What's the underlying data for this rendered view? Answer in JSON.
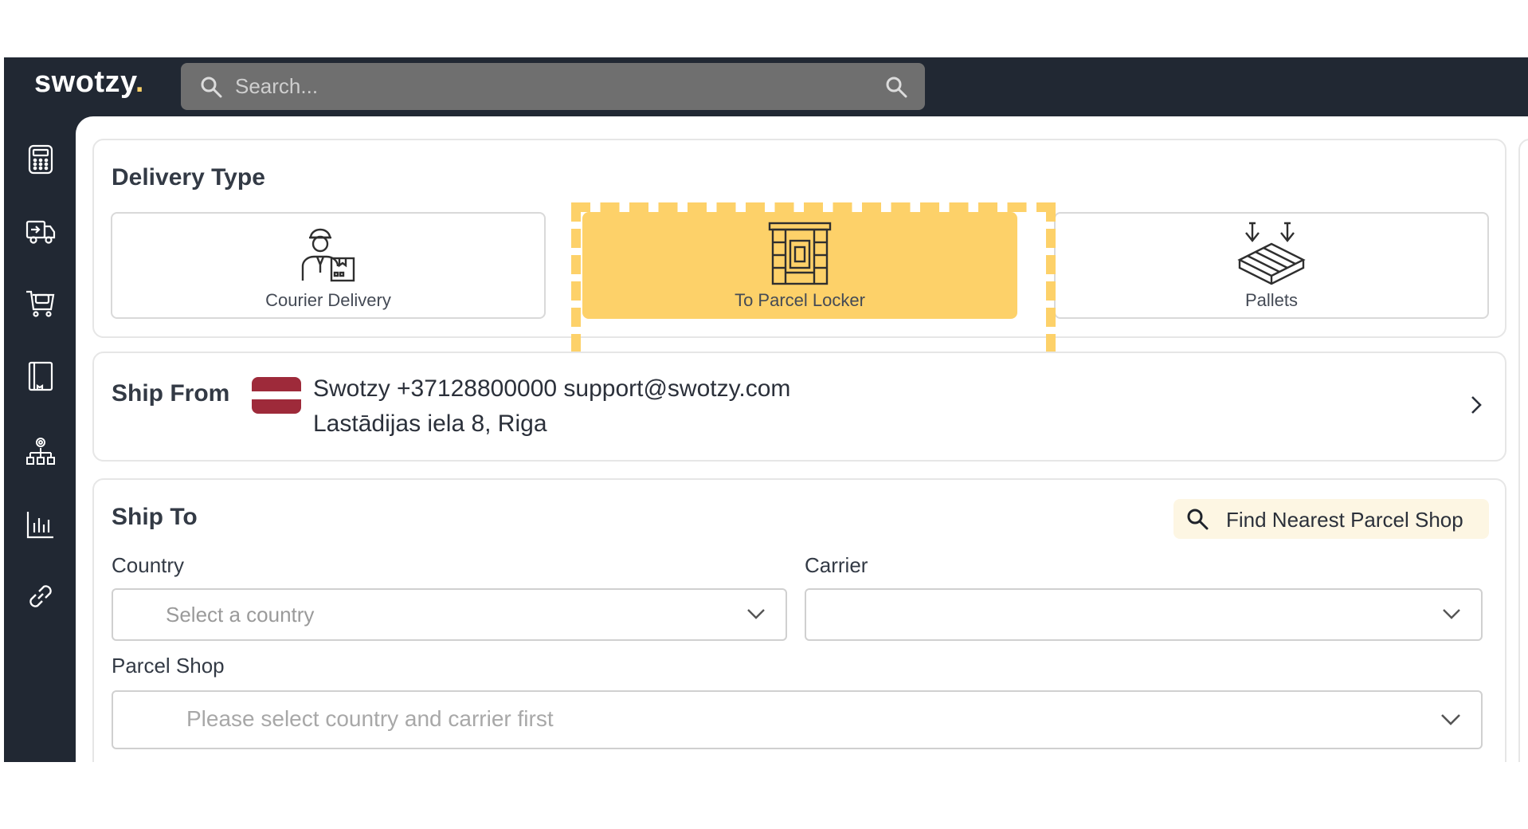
{
  "app": {
    "logo_text": "swotzy",
    "logo_dot": ".",
    "accent_color": "#fdd169",
    "sidebar_color": "#212833"
  },
  "search": {
    "placeholder": "Search..."
  },
  "sidebar": {
    "items": [
      {
        "icon": "calculator-icon"
      },
      {
        "icon": "delivery-truck-icon"
      },
      {
        "icon": "shopping-cart-icon"
      },
      {
        "icon": "address-book-icon"
      },
      {
        "icon": "organization-settings-icon"
      },
      {
        "icon": "bar-chart-icon"
      },
      {
        "icon": "link-icon"
      }
    ]
  },
  "delivery_type": {
    "title": "Delivery Type",
    "options": [
      {
        "label": "Courier Delivery",
        "icon": "courier-icon",
        "selected": false
      },
      {
        "label": "To Parcel Locker",
        "icon": "parcel-locker-icon",
        "selected": true
      },
      {
        "label": "Pallets",
        "icon": "pallets-icon",
        "selected": false
      }
    ]
  },
  "ship_from": {
    "title": "Ship From",
    "flag": "latvia-flag",
    "line1": "Swotzy +37128800000 support@swotzy.com",
    "line2": "Lastādijas iela 8, Riga"
  },
  "ship_to": {
    "title": "Ship To",
    "find_button_label": "Find Nearest Parcel Shop",
    "country_label": "Country",
    "country_placeholder": "Select a country",
    "carrier_label": "Carrier",
    "carrier_value": "",
    "parcel_shop_label": "Parcel Shop",
    "parcel_shop_placeholder": "Please select country and carrier first"
  }
}
